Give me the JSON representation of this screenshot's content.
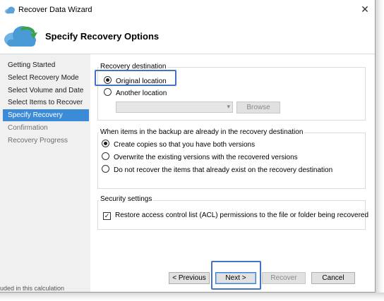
{
  "window": {
    "title": "Recover Data Wizard",
    "close_glyph": "✕",
    "app_icon": "cloud-icon"
  },
  "header": {
    "title": "Specify Recovery Options",
    "icon": "cloud-recover-icon"
  },
  "sidebar": {
    "steps": [
      {
        "label": "Getting Started",
        "state": "normal"
      },
      {
        "label": "Select Recovery Mode",
        "state": "normal"
      },
      {
        "label": "Select Volume and Date",
        "state": "normal"
      },
      {
        "label": "Select Items to Recover",
        "state": "normal"
      },
      {
        "label": "Specify Recovery Options",
        "state": "active"
      },
      {
        "label": "Confirmation",
        "state": "disabled"
      },
      {
        "label": "Recovery Progress",
        "state": "disabled"
      }
    ]
  },
  "recovery_destination": {
    "label": "Recovery destination",
    "original_location": "Original location",
    "another_location": "Another location",
    "selected": "original_location",
    "location_value": "",
    "browse_label": "Browse"
  },
  "conflict": {
    "label": "When items in the backup are already in the recovery destination",
    "options": [
      "Create copies so that you have both versions",
      "Overwrite the existing versions with the recovered versions",
      "Do not recover the items that already exist on the recovery destination"
    ],
    "selected_index": 0
  },
  "security": {
    "label": "Security settings",
    "acl_label": "Restore access control list (ACL) permissions to the file or folder being recovered",
    "acl_checked": true,
    "check_glyph": "✓"
  },
  "buttons": {
    "previous": "< Previous",
    "next": "Next >",
    "recover": "Recover",
    "cancel": "Cancel"
  },
  "background_text": "uded in this calculation",
  "colors": {
    "accent": "#3c8bd9",
    "highlight_box": "#4472c4"
  }
}
